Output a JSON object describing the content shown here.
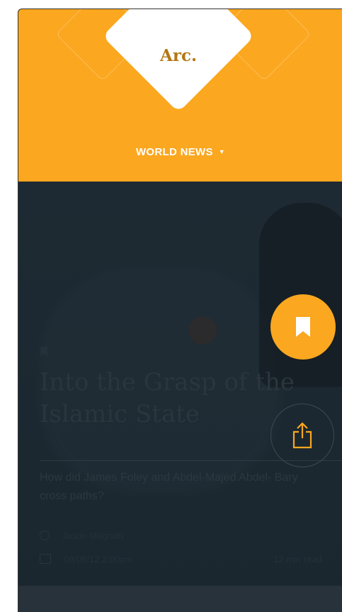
{
  "brand": {
    "logo_text": "Arc.",
    "accent_color": "#fba71f"
  },
  "nav": {
    "section_label": "WORLD NEWS",
    "caret_icon": "caret-down-icon"
  },
  "article": {
    "title": "Into the Grasp of the Islamic State",
    "subtitle": "How did James Foley and Abdel-Majed Abdel- Bary cross paths?",
    "author": "Jason Magrath",
    "date": "08/08/12 2:00pm",
    "read_time": "12 min read"
  },
  "actions": {
    "bookmark_icon": "bookmark-icon",
    "share_icon": "share-icon"
  }
}
